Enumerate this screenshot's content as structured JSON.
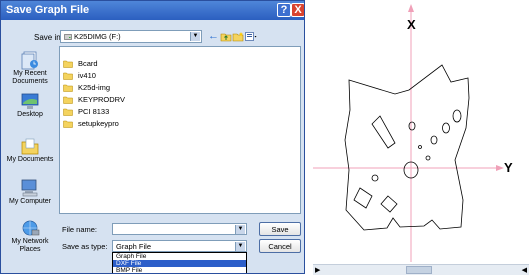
{
  "dialog": {
    "title": "Save Graph File",
    "help_glyph": "?",
    "close_glyph": "X",
    "save_in_label": "Save in:",
    "save_in_value": "K25DIMG (F:)",
    "places": [
      {
        "label": "My Recent Documents",
        "icon": "recent-documents-icon"
      },
      {
        "label": "Desktop",
        "icon": "desktop-icon"
      },
      {
        "label": "My Documents",
        "icon": "my-documents-icon"
      },
      {
        "label": "My Computer",
        "icon": "my-computer-icon"
      },
      {
        "label": "My Network Places",
        "icon": "network-places-icon"
      }
    ],
    "files": [
      "Bcard",
      "iv410",
      "K25d-img",
      "KEYPRODRV",
      "PCI 8133",
      "setupkeypro"
    ],
    "file_name_label": "File name:",
    "file_name_value": "",
    "save_type_label": "Save as type:",
    "save_type_value": "Graph File",
    "type_options": [
      "Graph File",
      "DXF File",
      "BMP File"
    ],
    "selected_type": "DXF File",
    "save_button": "Save",
    "cancel_button": "Cancel"
  },
  "canvas": {
    "x_axis_label": "X",
    "y_axis_label": "Y",
    "axis_color": "#f0a0b8",
    "outline_color": "#000000"
  }
}
